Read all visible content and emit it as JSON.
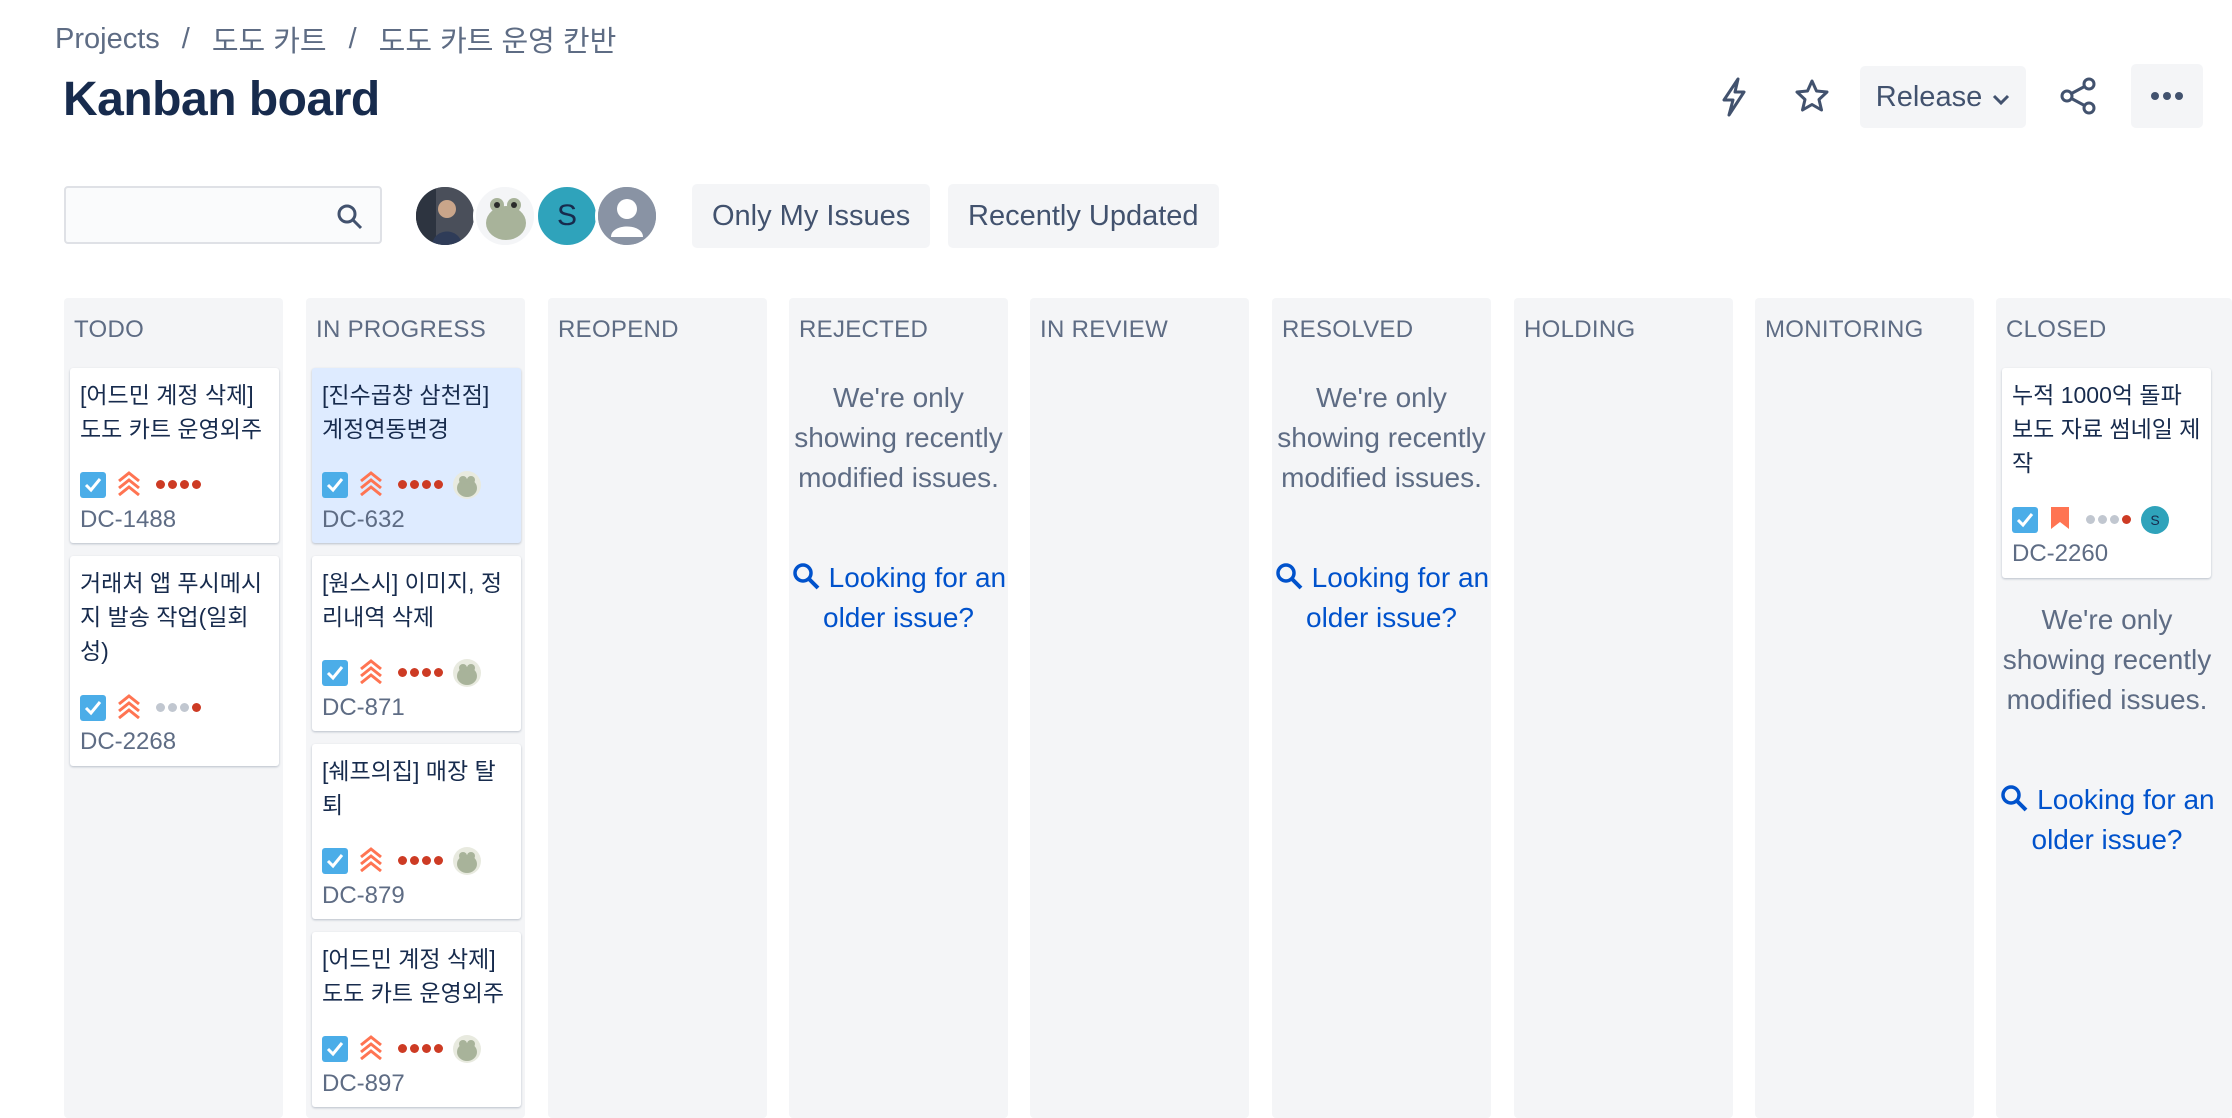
{
  "breadcrumb": {
    "root": "Projects",
    "project": "도도 카트",
    "board": "도도 카트 운영 칸반"
  },
  "title": "Kanban board",
  "header": {
    "release_label": "Release"
  },
  "search": {
    "value": "",
    "placeholder": ""
  },
  "avatars": [
    {
      "initial": ""
    },
    {
      "initial": ""
    },
    {
      "initial": "S"
    },
    {
      "initial": ""
    }
  ],
  "filters": {
    "only_my_issues": "Only My Issues",
    "recently_updated": "Recently Updated"
  },
  "colors": {
    "accent": "#0052cc",
    "story": "#4bade8",
    "priority": "#ff7452",
    "dot_red": "#cd3b24",
    "dot_gray": "#c1c7d0",
    "teal": "#2fa3bb"
  },
  "notice": {
    "text": "We're only showing recently modified issues.",
    "link": "Looking for an older issue?"
  },
  "columns": [
    {
      "title": "TODO",
      "cards": [
        {
          "summary": "[어드민 계정 삭제] 도도 카트 운영외주",
          "key": "DC-1488"
        },
        {
          "summary": "거래처 앱 푸시메시지 발송 작업(일회성)",
          "key": "DC-2268"
        }
      ]
    },
    {
      "title": "IN PROGRESS",
      "cards": [
        {
          "summary": "[진수곱창 삼천점] 계정연동변경",
          "key": "DC-632"
        },
        {
          "summary": "[원스시] 이미지, 정리내역 삭제",
          "key": "DC-871"
        },
        {
          "summary": "[쉐프의집] 매장 탈퇴",
          "key": "DC-879"
        },
        {
          "summary": "[어드민 계정 삭제] 도도 카트 운영외주",
          "key": "DC-897"
        }
      ]
    },
    {
      "title": "REOPEND"
    },
    {
      "title": "REJECTED"
    },
    {
      "title": "IN REVIEW"
    },
    {
      "title": "RESOLVED"
    },
    {
      "title": "HOLDING"
    },
    {
      "title": "MONITORING"
    },
    {
      "title": "CLOSED",
      "cards": [
        {
          "summary": "누적 1000억 돌파 보도 자료 썸네일 제작",
          "key": "DC-2260",
          "assignee_initial": "S"
        }
      ]
    }
  ]
}
